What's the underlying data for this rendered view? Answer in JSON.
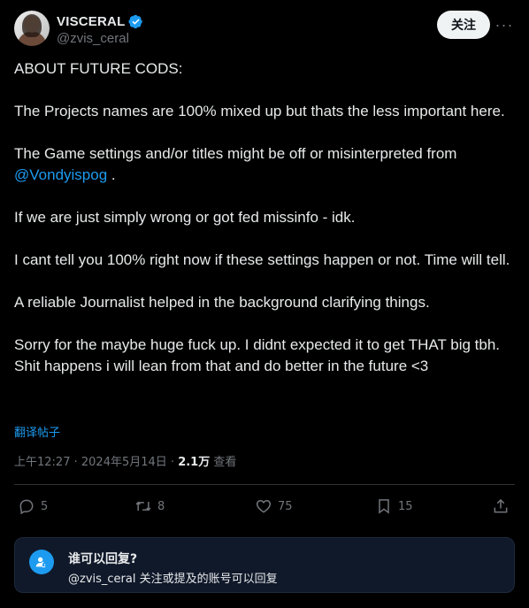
{
  "author": {
    "name": "VISCERAL",
    "handle": "@zvis_ceral",
    "verified": true
  },
  "header": {
    "follow_label": "关注",
    "more_label": "···"
  },
  "tweet": {
    "p1": "ABOUT FUTURE CODS:",
    "p2": "The Projects names are 100% mixed up but thats the less important here.",
    "p3_before": "The Game settings and/or titles might be off or misinterpreted from ",
    "p3_mention": "@Vondyispog",
    "p3_after": " .",
    "p4": "If we are just simply wrong or got fed missinfo - idk.",
    "p5": "I cant tell you 100% right now if these settings happen or not. Time will tell.",
    "p6": "A reliable Journalist helped in the background clarifying things.",
    "p7": "Sorry for the maybe huge fuck up. I didnt expected it to get THAT big tbh. Shit happens i will lean from that and do better in the future <3"
  },
  "translate_label": "翻译帖子",
  "meta": {
    "time": "上午12:27",
    "sep1": " · ",
    "date": "2024年5月14日",
    "sep2": " · ",
    "views_count": "2.1万",
    "views_label": " 查看"
  },
  "actions": {
    "replies": "5",
    "reposts": "8",
    "likes": "75",
    "bookmarks": "15"
  },
  "reply_restriction": {
    "title": "谁可以回复?",
    "subtitle": "@zvis_ceral 关注或提及的账号可以回复"
  },
  "colors": {
    "background": "#000000",
    "accent": "#1d9bf0",
    "text": "#e7e9ea",
    "muted": "#71767b"
  }
}
